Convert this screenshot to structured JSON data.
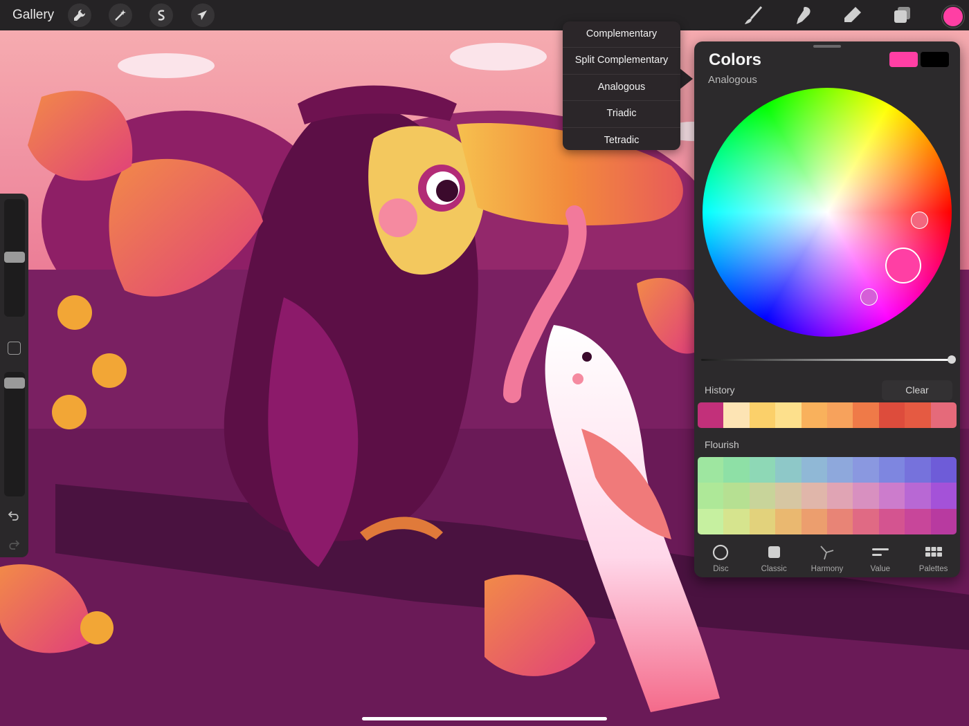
{
  "toolbar": {
    "gallery_label": "Gallery",
    "left_tools": [
      "wrench-icon",
      "magic-wand-icon",
      "selection-icon",
      "transform-arrow-icon"
    ],
    "right_tools": [
      "brush-icon",
      "smudge-icon",
      "eraser-icon",
      "layers-icon"
    ],
    "current_color": "#ff3fa4"
  },
  "harmony_menu": {
    "items": [
      "Complementary",
      "Split Complementary",
      "Analogous",
      "Triadic",
      "Tetradic"
    ]
  },
  "colors_panel": {
    "title": "Colors",
    "mode": "Analogous",
    "primary_swatch": "#ff3fa4",
    "secondary_swatch": "#000000",
    "history_label": "History",
    "clear_label": "Clear",
    "history_colors": [
      "#c2307a",
      "#fde4b4",
      "#fbd06a",
      "#fde08c",
      "#f9b15c",
      "#f7a25c",
      "#ef7a48",
      "#dd4c3c",
      "#e55a42",
      "#e56a7a"
    ],
    "palette_label": "Flourish",
    "palette_colors": [
      "#9ee6a0",
      "#8ee0a6",
      "#8ed8b6",
      "#8ec8c8",
      "#90b8d6",
      "#8ea8dc",
      "#8a98e0",
      "#7e86e0",
      "#7672dc",
      "#6e5cd8",
      "#aee898",
      "#b6e092",
      "#c8d49a",
      "#d6c6a2",
      "#e0b6aa",
      "#e0a4b4",
      "#d890c0",
      "#cc7ccc",
      "#b868d4",
      "#a452d8",
      "#c6f0a0",
      "#d6e48e",
      "#e2d27c",
      "#eab870",
      "#ec9e6e",
      "#e88476",
      "#e06a84",
      "#d45490",
      "#c8469a",
      "#b83aa0"
    ],
    "tabs": [
      {
        "label": "Disc",
        "icon": "disc-icon"
      },
      {
        "label": "Classic",
        "icon": "classic-square-icon"
      },
      {
        "label": "Harmony",
        "icon": "harmony-icon"
      },
      {
        "label": "Value",
        "icon": "value-sliders-icon"
      },
      {
        "label": "Palettes",
        "icon": "palettes-grid-icon"
      }
    ]
  }
}
